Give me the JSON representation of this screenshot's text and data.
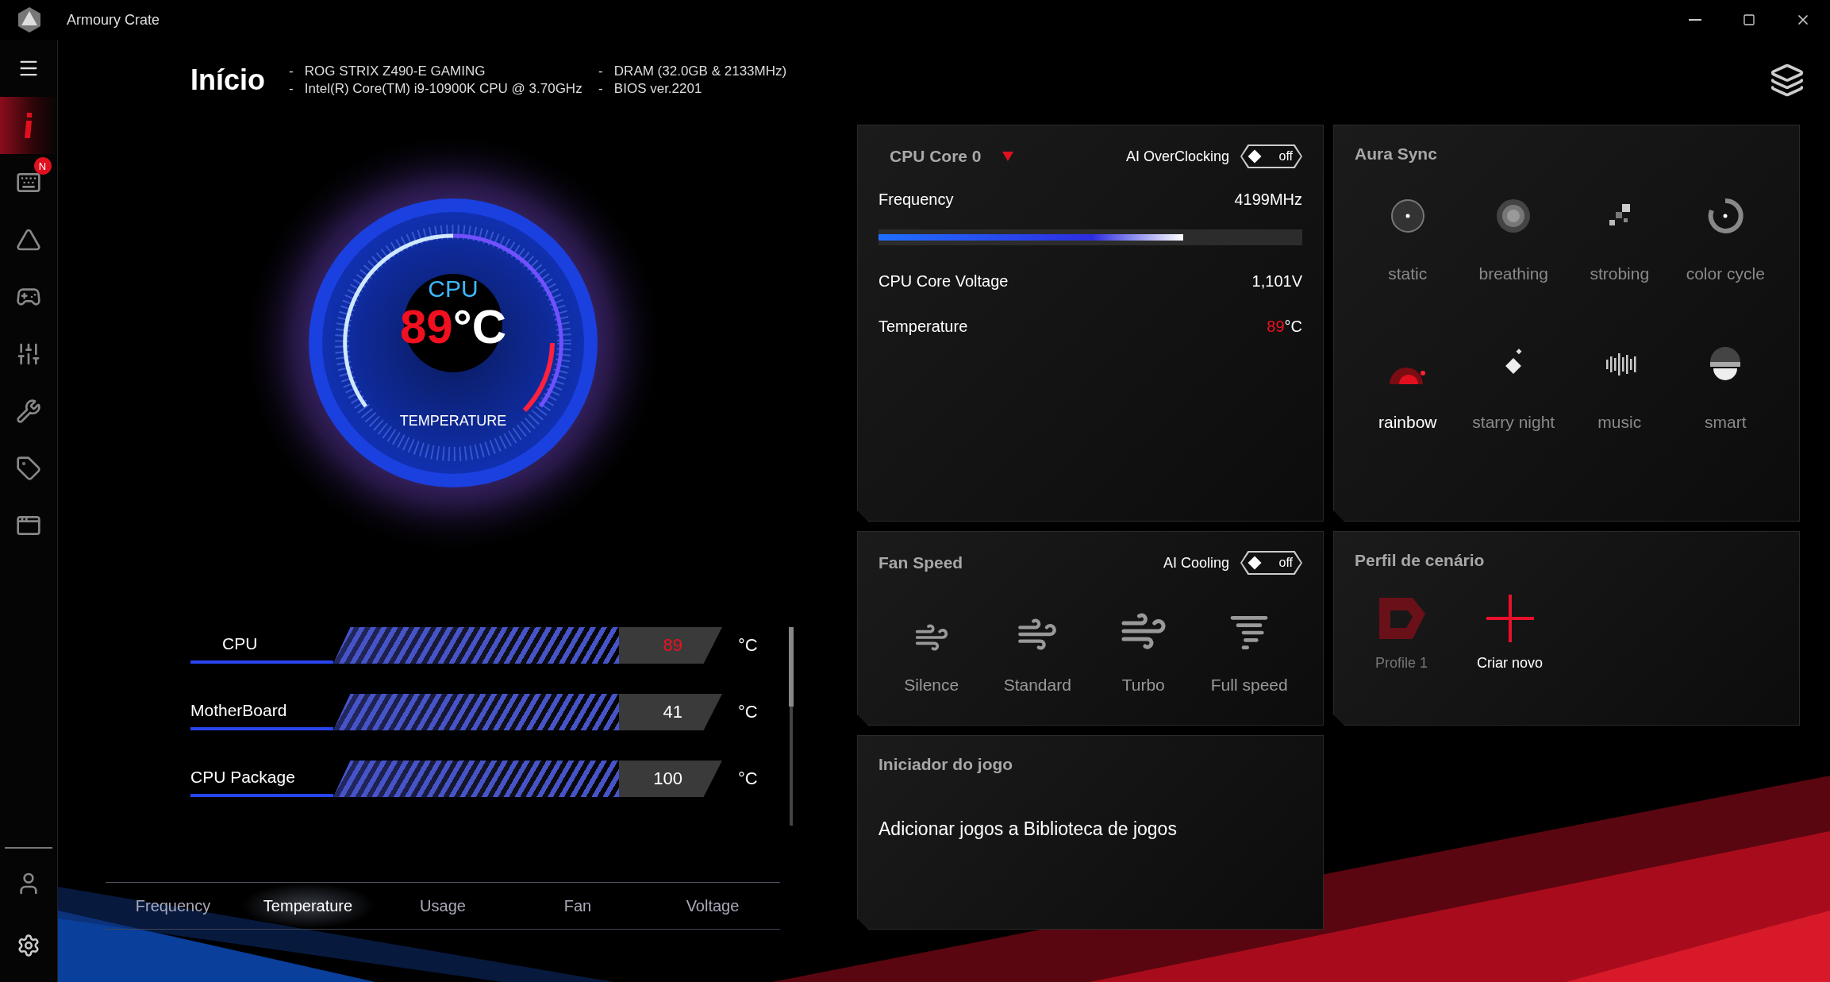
{
  "window": {
    "title": "Armoury Crate"
  },
  "sidebar": {
    "items": [
      {
        "selected": true
      },
      {
        "selected": false,
        "badge": "N"
      },
      {
        "selected": false
      },
      {
        "selected": false
      },
      {
        "selected": false
      },
      {
        "selected": false
      },
      {
        "selected": false
      },
      {
        "selected": false
      }
    ]
  },
  "header": {
    "title": "Início",
    "specs": [
      "-   ROG STRIX Z490-E GAMING",
      "-   Intel(R) Core(TM) i9-10900K CPU @ 3.70GHz",
      "-   DRAM (32.0GB & 2133MHz)",
      "-   BIOS ver.2201"
    ]
  },
  "gauge": {
    "label": "CPU",
    "value": "89",
    "unit": "°C",
    "caption": "TEMPERATURE"
  },
  "sensors": [
    {
      "name": "CPU",
      "value": "89",
      "unit": "°C",
      "warning": true
    },
    {
      "name": "MotherBoard",
      "value": "41",
      "unit": "°C",
      "warning": false
    },
    {
      "name": "CPU Package",
      "value": "100",
      "unit": "°C",
      "warning": false
    }
  ],
  "tabs": [
    {
      "label": "Frequency",
      "selected": false
    },
    {
      "label": "Temperature",
      "selected": true
    },
    {
      "label": "Usage",
      "selected": false
    },
    {
      "label": "Fan",
      "selected": false
    },
    {
      "label": "Voltage",
      "selected": false
    }
  ],
  "cpu_panel": {
    "selector": "CPU Core 0",
    "toggle": {
      "label": "AI OverClocking",
      "state": "off",
      "on": false
    },
    "rows": [
      {
        "label": "Frequency",
        "value": "4199MHz",
        "level": 0.72
      },
      {
        "label": "CPU Core Voltage",
        "value": "1,101V"
      },
      {
        "label": "Temperature",
        "value": "89",
        "unit": "°C",
        "warning": true
      }
    ]
  },
  "aura_sync": {
    "title": "Aura Sync",
    "effects": [
      {
        "name": "static",
        "selected": false
      },
      {
        "name": "breathing",
        "selected": false
      },
      {
        "name": "strobing",
        "selected": false
      },
      {
        "name": "color cycle",
        "selected": false
      },
      {
        "name": "rainbow",
        "selected": true
      },
      {
        "name": "starry night",
        "selected": false
      },
      {
        "name": "music",
        "selected": false
      },
      {
        "name": "smart",
        "selected": false
      }
    ]
  },
  "fan_speed": {
    "title": "Fan Speed",
    "toggle": {
      "label": "AI Cooling",
      "state": "off",
      "on": false
    },
    "modes": [
      "Silence",
      "Standard",
      "Turbo",
      "Full speed"
    ]
  },
  "scenario": {
    "title": "Perfil de cenário",
    "items": [
      {
        "kind": "profile",
        "name": "Profile 1"
      },
      {
        "kind": "create",
        "name": "Criar novo"
      }
    ]
  },
  "launcher": {
    "title": "Iniciador do jogo",
    "text": "Adicionar jogos a Biblioteca de jogos"
  }
}
